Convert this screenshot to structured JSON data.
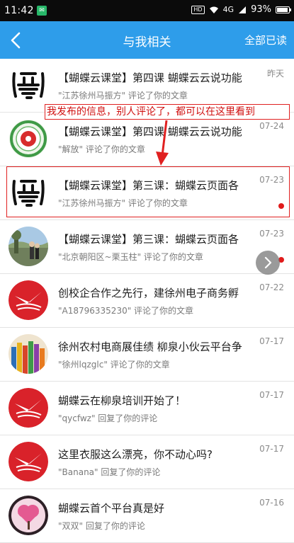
{
  "status": {
    "time": "11:42",
    "notif": "✉",
    "hd": "HD",
    "network": "4G",
    "battery": "93%"
  },
  "header": {
    "title": "与我相关",
    "action": "全部已读"
  },
  "annotation": "我发布的信息，别人评论了，都可以在这里看到",
  "items": [
    {
      "title": "【蝴蝶云课堂】第四课 蝴蝶云云说功能",
      "sub": "\"江苏徐州马振方\" 评论了你的文章",
      "date": "昨天"
    },
    {
      "title": "【蝴蝶云课堂】第四课 蝴蝶云云说功能",
      "sub": "\"解放\" 评论了你的文章",
      "date": "07-24"
    },
    {
      "title": "【蝴蝶云课堂】第三课：蝴蝶云页面各",
      "sub": "\"江苏徐州马振方\" 评论了你的文章",
      "date": "07-23"
    },
    {
      "title": "【蝴蝶云课堂】第三课：蝴蝶云页面各",
      "sub": "\"北京朝阳区~栗玉柱\" 评论了你的文章",
      "date": "07-23"
    },
    {
      "title": "创校企合作之先行，建徐州电子商务孵",
      "sub": "\"A18796335230\" 评论了你的文章",
      "date": "07-22"
    },
    {
      "title": "徐州农村电商展佳绩 柳泉小伙云平台争",
      "sub": "\"徐州lqzglc\" 评论了你的文章",
      "date": "07-17"
    },
    {
      "title": "蝴蝶云在柳泉培训开始了！",
      "sub": "\"qycfwz\" 回复了你的评论",
      "date": "07-17"
    },
    {
      "title": "这里衣服这么漂亮，你不动心吗?",
      "sub": "\"Banana\" 回复了你的评论",
      "date": "07-17"
    },
    {
      "title": "蝴蝶云首个平台真是好",
      "sub": "\"双双\" 回复了你的评论",
      "date": "07-16"
    }
  ]
}
